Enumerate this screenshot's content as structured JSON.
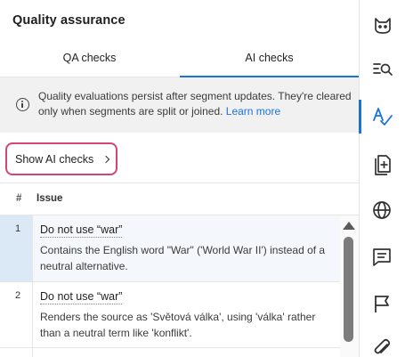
{
  "panel": {
    "title": "Quality assurance",
    "tabs": [
      {
        "label": "QA checks",
        "active": false
      },
      {
        "label": "AI checks",
        "active": true
      }
    ],
    "info": {
      "text": "Quality evaluations persist after segment updates. They're cleared only when segments are split or joined. ",
      "link": "Learn more"
    },
    "show_ai_button": "Show AI checks",
    "table": {
      "columns": [
        "#",
        "Issue"
      ],
      "rows": [
        {
          "num": "1",
          "title": "Do not use “war”",
          "desc": "Contains the English word \"War\" ('World War II') instead of a neutral alternative.",
          "selected": true
        },
        {
          "num": "2",
          "title": "Do not use “war”",
          "desc": "Renders the source as 'Světová válka', using 'válka' rather than a neutral term like 'konflikt'.",
          "selected": false
        }
      ]
    }
  },
  "rail": {
    "items": [
      {
        "icon": "cat-icon",
        "active": false
      },
      {
        "icon": "search-list-icon",
        "active": false
      },
      {
        "icon": "spell-check-icon",
        "active": true
      },
      {
        "icon": "document-plus-icon",
        "active": false
      },
      {
        "icon": "globe-icon",
        "active": false
      },
      {
        "icon": "comment-icon",
        "active": false
      },
      {
        "icon": "flag-icon",
        "active": false
      },
      {
        "icon": "paperclip-icon",
        "active": false
      }
    ]
  },
  "colors": {
    "accent": "#1a73d9",
    "highlight_border": "#d24672",
    "selected_row": "#dbe9f7",
    "info_bg": "#f1f1f1"
  }
}
